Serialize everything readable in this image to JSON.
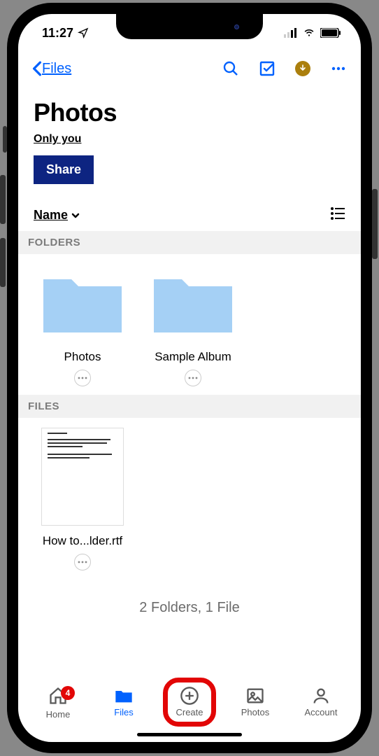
{
  "statusBar": {
    "time": "11:27"
  },
  "nav": {
    "backLabel": "Files"
  },
  "header": {
    "title": "Photos",
    "accessText": "Only you",
    "shareLabel": "Share"
  },
  "sort": {
    "label": "Name"
  },
  "sections": {
    "foldersHeader": "FOLDERS",
    "filesHeader": "FILES"
  },
  "folders": [
    {
      "name": "Photos"
    },
    {
      "name": "Sample Album"
    }
  ],
  "files": [
    {
      "name": "How to...lder.rtf"
    }
  ],
  "summary": "2 Folders, 1 File",
  "tabs": {
    "home": {
      "label": "Home",
      "badge": "4"
    },
    "files": {
      "label": "Files"
    },
    "create": {
      "label": "Create"
    },
    "photos": {
      "label": "Photos"
    },
    "account": {
      "label": "Account"
    }
  },
  "colors": {
    "accent": "#0061fe",
    "shareBg": "#0d2481",
    "badge": "#e20606",
    "gold": "#ab7f0d"
  }
}
